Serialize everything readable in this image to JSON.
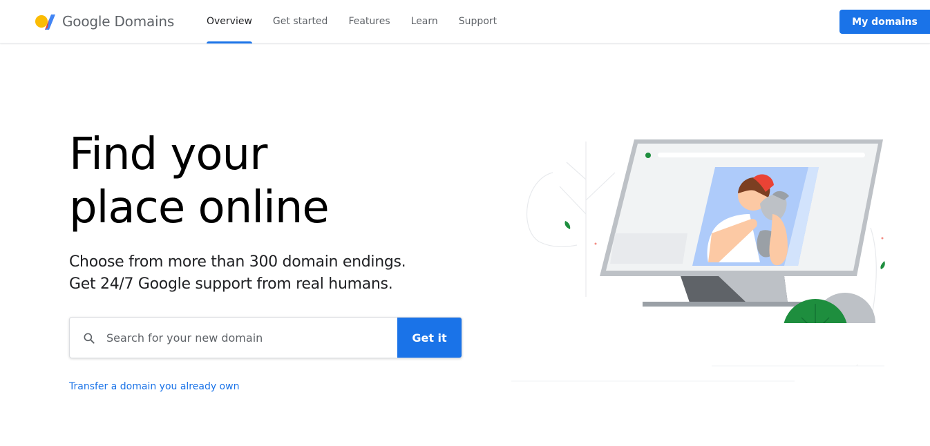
{
  "header": {
    "brand": "Google Domains",
    "logo_icon": "google-domains-logo-icon",
    "nav": [
      {
        "label": "Overview",
        "active": true
      },
      {
        "label": "Get started",
        "active": false
      },
      {
        "label": "Features",
        "active": false
      },
      {
        "label": "Learn",
        "active": false
      },
      {
        "label": "Support",
        "active": false
      }
    ],
    "cta_label": "My domains"
  },
  "hero": {
    "title_line1": "Find your",
    "title_line2": "place online",
    "subtitle_line1": "Choose from more than 300 domain endings.",
    "subtitle_line2": "Get 24/7 Google support from real humans.",
    "search": {
      "icon": "search-icon",
      "placeholder": "Search for your new domain",
      "value": "",
      "button_label": "Get it"
    },
    "transfer_link": "Transfer a domain you already own"
  },
  "colors": {
    "accent": "#1a73e8",
    "text": "#202124",
    "muted": "#5f6368"
  }
}
